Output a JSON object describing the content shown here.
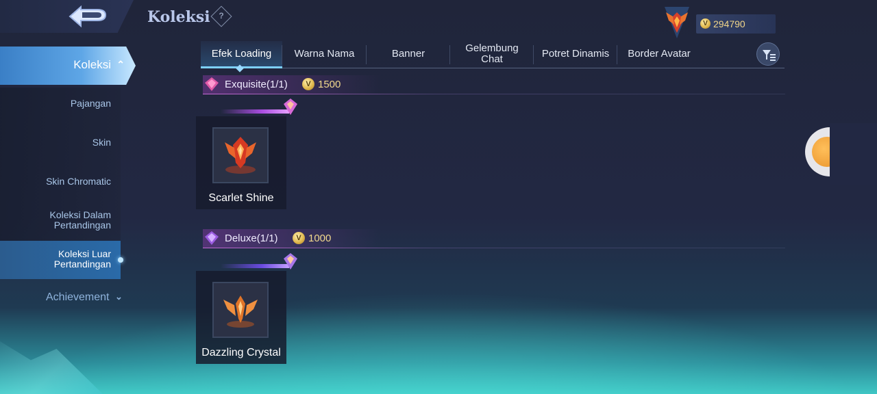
{
  "header": {
    "title": "Koleksi",
    "help_glyph": "?",
    "currency_value": "294790",
    "currency_icon": "coin-icon",
    "back_icon": "back-arrow-icon"
  },
  "sidebar": {
    "active_label": "Koleksi",
    "items": [
      {
        "label": "Pajangan"
      },
      {
        "label": "Skin"
      },
      {
        "label": "Skin Chromatic"
      },
      {
        "label": "Koleksi Dalam\nPertandingan"
      },
      {
        "label": "Koleksi Luar\nPertandingan",
        "selected": true
      }
    ],
    "achievement_label": "Achievement"
  },
  "tabs": [
    {
      "label": "Efek Loading",
      "active": true
    },
    {
      "label": "Warna Nama"
    },
    {
      "label": "Banner"
    },
    {
      "label": "Gelembung Chat"
    },
    {
      "label": "Potret Dinamis"
    },
    {
      "label": "Border Avatar"
    }
  ],
  "sections": [
    {
      "label": "Exquisite(1/1)",
      "price": "1500",
      "gem_color": "#e05aa8",
      "items": [
        {
          "name": "Scarlet Shine"
        }
      ]
    },
    {
      "label": "Deluxe(1/1)",
      "price": "1000",
      "gem_color": "#9a5be0",
      "items": [
        {
          "name": "Dazzling Crystal"
        }
      ]
    }
  ],
  "colors": {
    "accent": "#5ea6e6",
    "section_line": "#c86bd8",
    "gold": "#f2d98e"
  }
}
